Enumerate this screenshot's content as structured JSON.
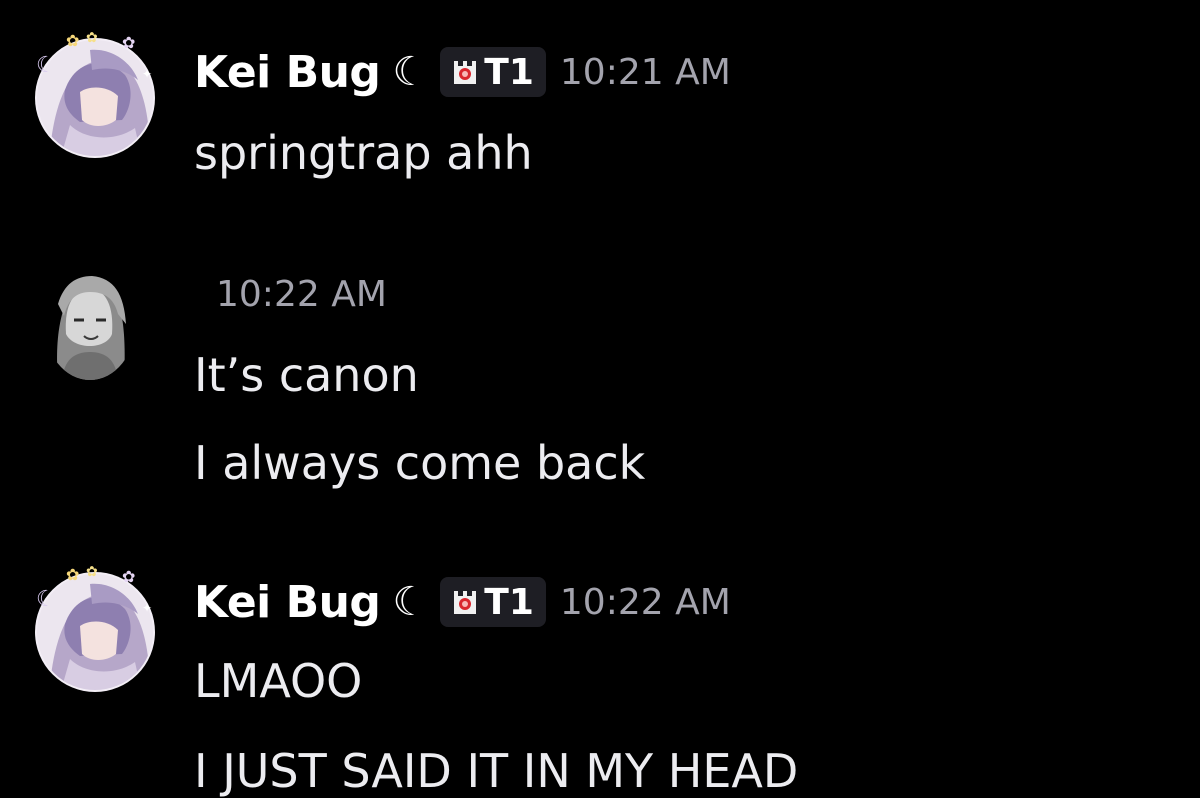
{
  "colors": {
    "background": "#000000",
    "username": "#ffffff",
    "message_text": "#ececf0",
    "timestamp": "#a3a3ad",
    "tag_background": "#1e1e24"
  },
  "messages": [
    {
      "author": "Kei Bug",
      "author_icon": "crescent-moon",
      "tag": "T1",
      "timestamp": "10:21 AM",
      "lines": [
        "springtrap ahh"
      ]
    },
    {
      "timestamp": "10:22 AM",
      "lines": [
        "It’s canon",
        "I always come back"
      ]
    },
    {
      "author": "Kei Bug",
      "author_icon": "crescent-moon",
      "tag": "T1",
      "timestamp": "10:22 AM",
      "lines": [
        "LMAOO",
        "I JUST SAID IT IN MY HEAD"
      ]
    }
  ]
}
